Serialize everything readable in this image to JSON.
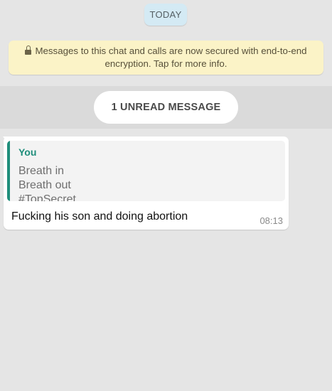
{
  "chat": {
    "date_label": "TODAY",
    "encryption_notice": "Messages to this chat and calls are now secured with end-to-end encryption. Tap for more info.",
    "unread_label": "1 UNREAD MESSAGE",
    "message": {
      "quote": {
        "author": "You",
        "lines": [
          "Breath in",
          "Breath out",
          "#TopSecret…"
        ]
      },
      "text": "Fucking his son and doing abortion",
      "time": "08:13"
    }
  },
  "colors": {
    "background": "#e5e5e5",
    "date_chip": "#d4eaf4",
    "encryption_notice": "#fbf3c7",
    "quote_accent": "#1f8e7b",
    "bubble": "#ffffff"
  },
  "icons": {
    "lock": "lock-icon"
  }
}
